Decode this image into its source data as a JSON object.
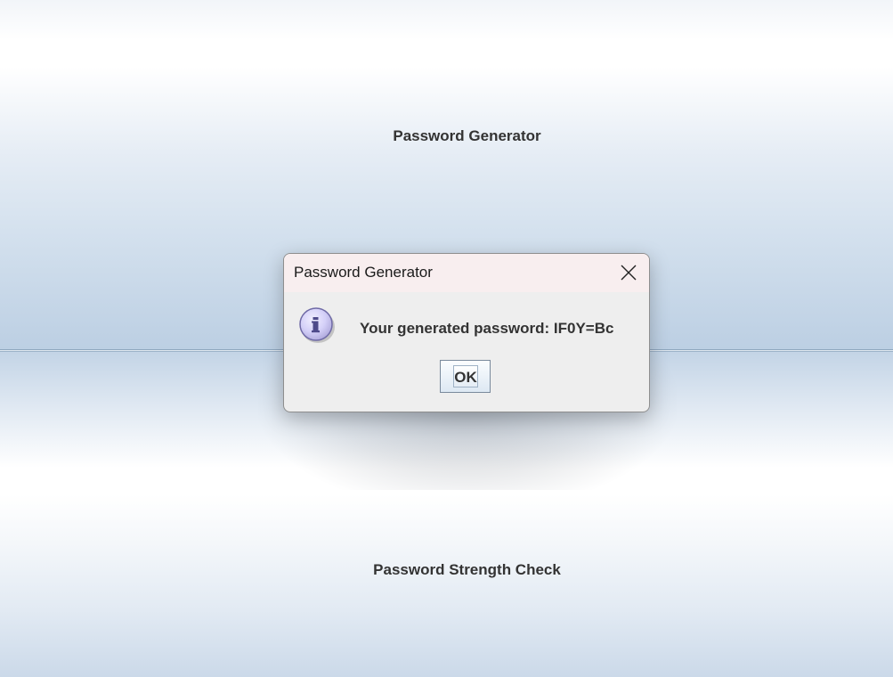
{
  "main": {
    "generate_button_label": "Password Generator",
    "strength_button_label": "Password Strength Check"
  },
  "dialog": {
    "title": "Password Generator",
    "message": "Your generated password: IF0Y=Bc",
    "ok_label": "OK",
    "icon": "info-icon",
    "close_icon": "close-icon"
  },
  "colors": {
    "panel_gradient_end": "#bccfe3",
    "dialog_title_bg": "#f8eeef",
    "dialog_body_bg": "#eeeeee",
    "info_icon_fill": "#d4d0f8",
    "info_icon_stroke": "#6f6aa6"
  }
}
